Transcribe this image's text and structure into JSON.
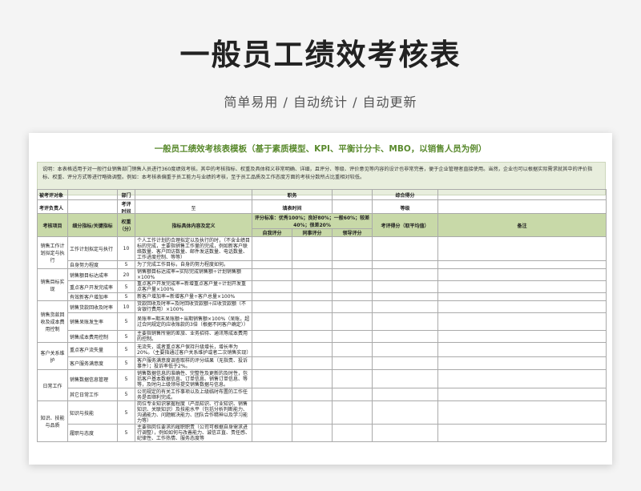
{
  "hero": {
    "title": "一般员工绩效考核表",
    "subtitle": "简单易用  /  自动统计  /  自动更新"
  },
  "sheet": {
    "title": "一般员工绩效考核表模板（基于素质模型、KPI、平衡计分卡、MBO，以销售人员为例）",
    "note": "说明：本表格适用于对一般行业销售部门销售人员进行360度绩效考核。其中的考核指标、权重及具体释义非常明确、详细，且评分、等级、评价意见等内容的设计也非常完善，便于企业管理者直接使用。当然，企业也可以根据实际需求就其中的评价指标、权重、评分方式等进行略微调整。例如：本考核表偏重于员工能力与业绩的考核，至于员工品质及工作态度方面的考核分数所占比重相对较低。",
    "info": {
      "label1": "被考评对象",
      "label2": "部门",
      "label3": "职务",
      "label4": "综合得分",
      "label5": "考评负责人",
      "label6": "考评时间",
      "label7": "至",
      "label8": "填表时间",
      "label9": "等级"
    },
    "headers": {
      "item": "考核项目",
      "sub": "细分指标/关键指标",
      "weight": "权重（分）",
      "desc": "指标具体内容及定义",
      "std": "评分标准：优秀100%；良好80%；一般60%；较差40%；很差20%",
      "self": "自我评分",
      "peer": "同事评分",
      "lead": "领导评分",
      "score": "考评得分（取平均值）",
      "remark": "备注"
    },
    "groups": [
      {
        "item": "销售工作计划拟定与执行",
        "rows": [
          {
            "sub": "工作计划拟定与执行",
            "weight": "10",
            "desc": "个人工作计划的合理拟定以及执行的时，（不含业绩目标的完成，主要指销售工作量的完成，例如新客户联络数量、客户回访数量、邮件发送数量、电话数量、工作进度控制、等等）"
          },
          {
            "sub": "自身努力程度",
            "weight": "5",
            "desc": "为了完成工作目标，自身的努力程度如何。"
          }
        ]
      },
      {
        "item": "销售目标实现",
        "rows": [
          {
            "sub": "销售额目标达成率",
            "weight": "20",
            "desc": "销售额目标达成率=实际完成销售额÷计划销售额×100%"
          },
          {
            "sub": "重点客户开发完成率",
            "weight": "5",
            "desc": "重点客户开发完成率=新增重点客户量÷计划开发重点客户量×100%"
          },
          {
            "sub": "有效新客户增加率",
            "weight": "5",
            "desc": "新客户增加率=新增客户量÷客户总量×100%"
          }
        ]
      },
      {
        "item": "销售货款回收及成本费用控制",
        "rows": [
          {
            "sub": "销售货款回收及时率",
            "weight": "10",
            "desc": "货款回收及时率=及时回收货款额÷应收货款额（不含银行费用）×100%"
          },
          {
            "sub": "销售呆账发生率",
            "weight": "5",
            "desc": "呆账率=期末呆账额÷当期销售额×100%（呆账，超过合同规定的应收账款的3倍（根据不同客户确定））"
          },
          {
            "sub": "销售成本费用控制",
            "weight": "5",
            "desc": "主要指销售所需的差旅、业务招待、通讯等成本费用的控制。"
          }
        ]
      },
      {
        "item": "客户关系维护",
        "rows": [
          {
            "sub": "重点客户流失量",
            "weight": "5",
            "desc": "无流失，或者重点客户保持升级增长，增长率为20%。（主要指通过客户关系维护或者二次销售实现）"
          },
          {
            "sub": "客户服务满意度",
            "weight": "5",
            "desc": "客户服务满意度调查取样的评分结果（无指责、投诉事件）；投诉率低于2%。"
          }
        ]
      },
      {
        "item": "日常工作",
        "rows": [
          {
            "sub": "销售数据信息管理",
            "weight": "5",
            "desc": "销售数据信息的准确性、完整性及更新的及时性，包括客户基本数据信息、订单信息、销售订单信息、等等，及时向上级领导提交销售数据与信息。"
          },
          {
            "sub": "其它日常工作",
            "weight": "5",
            "desc": "公司规定的有关工作事项以及上级临时布置的工作任务是否顺利完成。"
          }
        ]
      },
      {
        "item": "知识、技能与品质",
        "rows": [
          {
            "sub": "知识与技能",
            "weight": "5",
            "desc": "岗位专业知识掌握程度（产品知识、行业知识、销售知识、关联知识）及技能水平（包括分析判断能力、沟通能力、问题解决能力、团队合作精神以及学习能力等）"
          },
          {
            "sub": "履职与态度",
            "weight": "5",
            "desc": "主要指岗位要求的履职职责（公司可根据自身需求进行调整），例如如何与改善能力、诚信正直、责任感、纪律性、工作热情、服务态度等"
          }
        ]
      }
    ]
  }
}
